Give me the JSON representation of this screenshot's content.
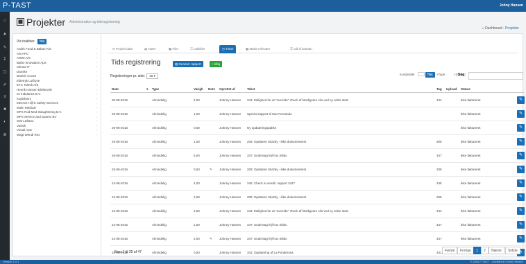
{
  "app": {
    "brand": "P-TAST",
    "user": "Johny Hansen"
  },
  "rail_icons": [
    "home-icon",
    "lock-icon",
    "wrench-icon",
    "chart-icon",
    "message-icon",
    "pencil-icon",
    "list-icon",
    "gauge-icon",
    "shield-icon",
    "plus-icon"
  ],
  "page": {
    "title": "Projekter",
    "subtitle": "Administration og tidsregistrering"
  },
  "breadcrumb": {
    "home": "Dashboard",
    "sep": "›",
    "current": "Projekter"
  },
  "left": {
    "vis_label": "Vis inaktive:",
    "vis_toggle": "Nej",
    "customers": [
      "Andrk Food & Bakari A/S",
      "AM APC",
      "ARWI A/S",
      "Baltic-Innovation ApS",
      "Climax IT",
      "Danske",
      "Danish Crown",
      "Elitetryk Lutfryse",
      "ETC Toleek A/S",
      "Henrik Hansen Elektronik",
      "IO Industries B.V.",
      "Kopisktory",
      "Mezrick H@S Safety Services",
      "Molin Medical",
      "MPS Rod Med Slaughtering B.V.",
      "MPS Service and Spares BV",
      "SMI Løftano",
      "Vassih",
      "Vinadi ApS",
      "Wagt Wendi Rex"
    ]
  },
  "tabs": [
    "Projekt data",
    "Noter",
    "Filer",
    "Udvikler",
    "Timer",
    "Møde referater",
    "Gå til kanban"
  ],
  "active_tab": "Timer",
  "section": {
    "title": "Tids registrering",
    "gen_report": "Generer rapport",
    "add": "+ tilføj"
  },
  "perpage": {
    "label": "Registreringer pr. side:",
    "value": "25"
  },
  "filters": {
    "kunde_label": "Kunde/alle",
    "kunde_toggle": "Nej",
    "type": "+Type",
    "status": "+Status",
    "search_label": "Søg:"
  },
  "table": {
    "headers": {
      "date": "Dato",
      "type": "Type",
      "varighed": "Varigh",
      "note": "Note",
      "oprettet": "Oprettet af",
      "tekst": "Tekst",
      "tag": "Tag",
      "upload": "Upload",
      "status": "Status"
    },
    "rows": [
      {
        "date": "30-08-2016",
        "type": "Almindelig",
        "var": "2,00",
        "note": "",
        "by": "Johnny Hansen",
        "text": "344: Mulighed for at \"override\" check af færdigvare silo ved ny ordre start.",
        "tag": "344",
        "status": "Ikke faktureret"
      },
      {
        "date": "29-08-2016",
        "type": "Almindelig",
        "var": "1,00",
        "note": "",
        "by": "Johnny Hansen",
        "text": "Special rapport til San Fernando",
        "tag": "",
        "status": "Ikke faktureret"
      },
      {
        "date": "29-08-2016",
        "type": "Almindelig",
        "var": "0,50",
        "note": "",
        "by": "Johnny Hansen",
        "text": "Ny opdateringspakke",
        "tag": "",
        "status": "Ikke faktureret"
      },
      {
        "date": "29-08-2016",
        "type": "Almindelig",
        "var": "1,00",
        "note": "",
        "by": "Johnny Hansen",
        "text": "209: Opdatere Slutzky - ikke dokumenteret",
        "tag": "209",
        "status": "Ikke faktureret"
      },
      {
        "date": "26-08-2016",
        "type": "Almindelig",
        "var": "6,00",
        "note": "",
        "by": "Johnny Hansen",
        "text": "347: Undersøg fejl hos Slitko",
        "tag": "347",
        "status": "Ikke faktureret"
      },
      {
        "date": "25-08-2016",
        "type": "Almindelig",
        "var": "0,50",
        "note": "✎",
        "by": "Johnny Hansen",
        "text": "209: Opdatere Slutzky - ikke dokumenteret",
        "tag": "209",
        "status": "Ikke faktureret"
      },
      {
        "date": "24-08-2016",
        "type": "Almindelig",
        "var": "4,00",
        "note": "",
        "by": "Johnny Hansen",
        "text": "345: Check in-vendt i rapport 3427",
        "tag": "345",
        "status": "Ikke faktureret"
      },
      {
        "date": "24-08-2016",
        "type": "Almindelig",
        "var": "2,50",
        "note": "",
        "by": "Johnny Hansen",
        "text": "209: Opdatere Slutzky - ikke dokumenteret",
        "tag": "209",
        "status": "Ikke faktureret"
      },
      {
        "date": "24-08-2016",
        "type": "Almindelig",
        "var": "2,50",
        "note": "",
        "by": "Johnny Hansen",
        "text": "344: Mulighed for at \"override\" check af færdigvare silo ved ny ordre start.",
        "tag": "344",
        "status": "Ikke faktureret"
      },
      {
        "date": "24-08-2016",
        "type": "Almindelig",
        "var": "1,50",
        "note": "",
        "by": "Johnny Hansen",
        "text": "347: Undersøg fejl hos Slitko",
        "tag": "347",
        "status": "Ikke faktureret"
      },
      {
        "date": "22-08-2016",
        "type": "Almindelig",
        "var": "2,00",
        "note": "✎",
        "by": "Johnny Hansen",
        "text": "347: Undersøg fejl hos Slitko",
        "tag": "347",
        "status": "Ikke faktureret"
      },
      {
        "date": "22-08-2016",
        "type": "Almindelig",
        "var": "0,50",
        "note": "",
        "by": "Johnny Hansen",
        "text": "341: Opdatering af La Ponderosa",
        "tag": "341",
        "status": "Ikke faktureret"
      }
    ]
  },
  "footer": {
    "viser": "Viser 1 til 25 af 47"
  },
  "pager": {
    "first": "Første",
    "prev": "Forrige",
    "p1": "1",
    "p2": "2",
    "next": "Næste",
    "last": "Sidste"
  },
  "bottombar": {
    "left": "Version 1.0.1",
    "right": "© 2016 P-TAST - Udviklet af Johny Hansen"
  },
  "colors": {
    "brand": "#1c5f9c",
    "accent": "#1c6eb4",
    "rail": "#24292f"
  }
}
